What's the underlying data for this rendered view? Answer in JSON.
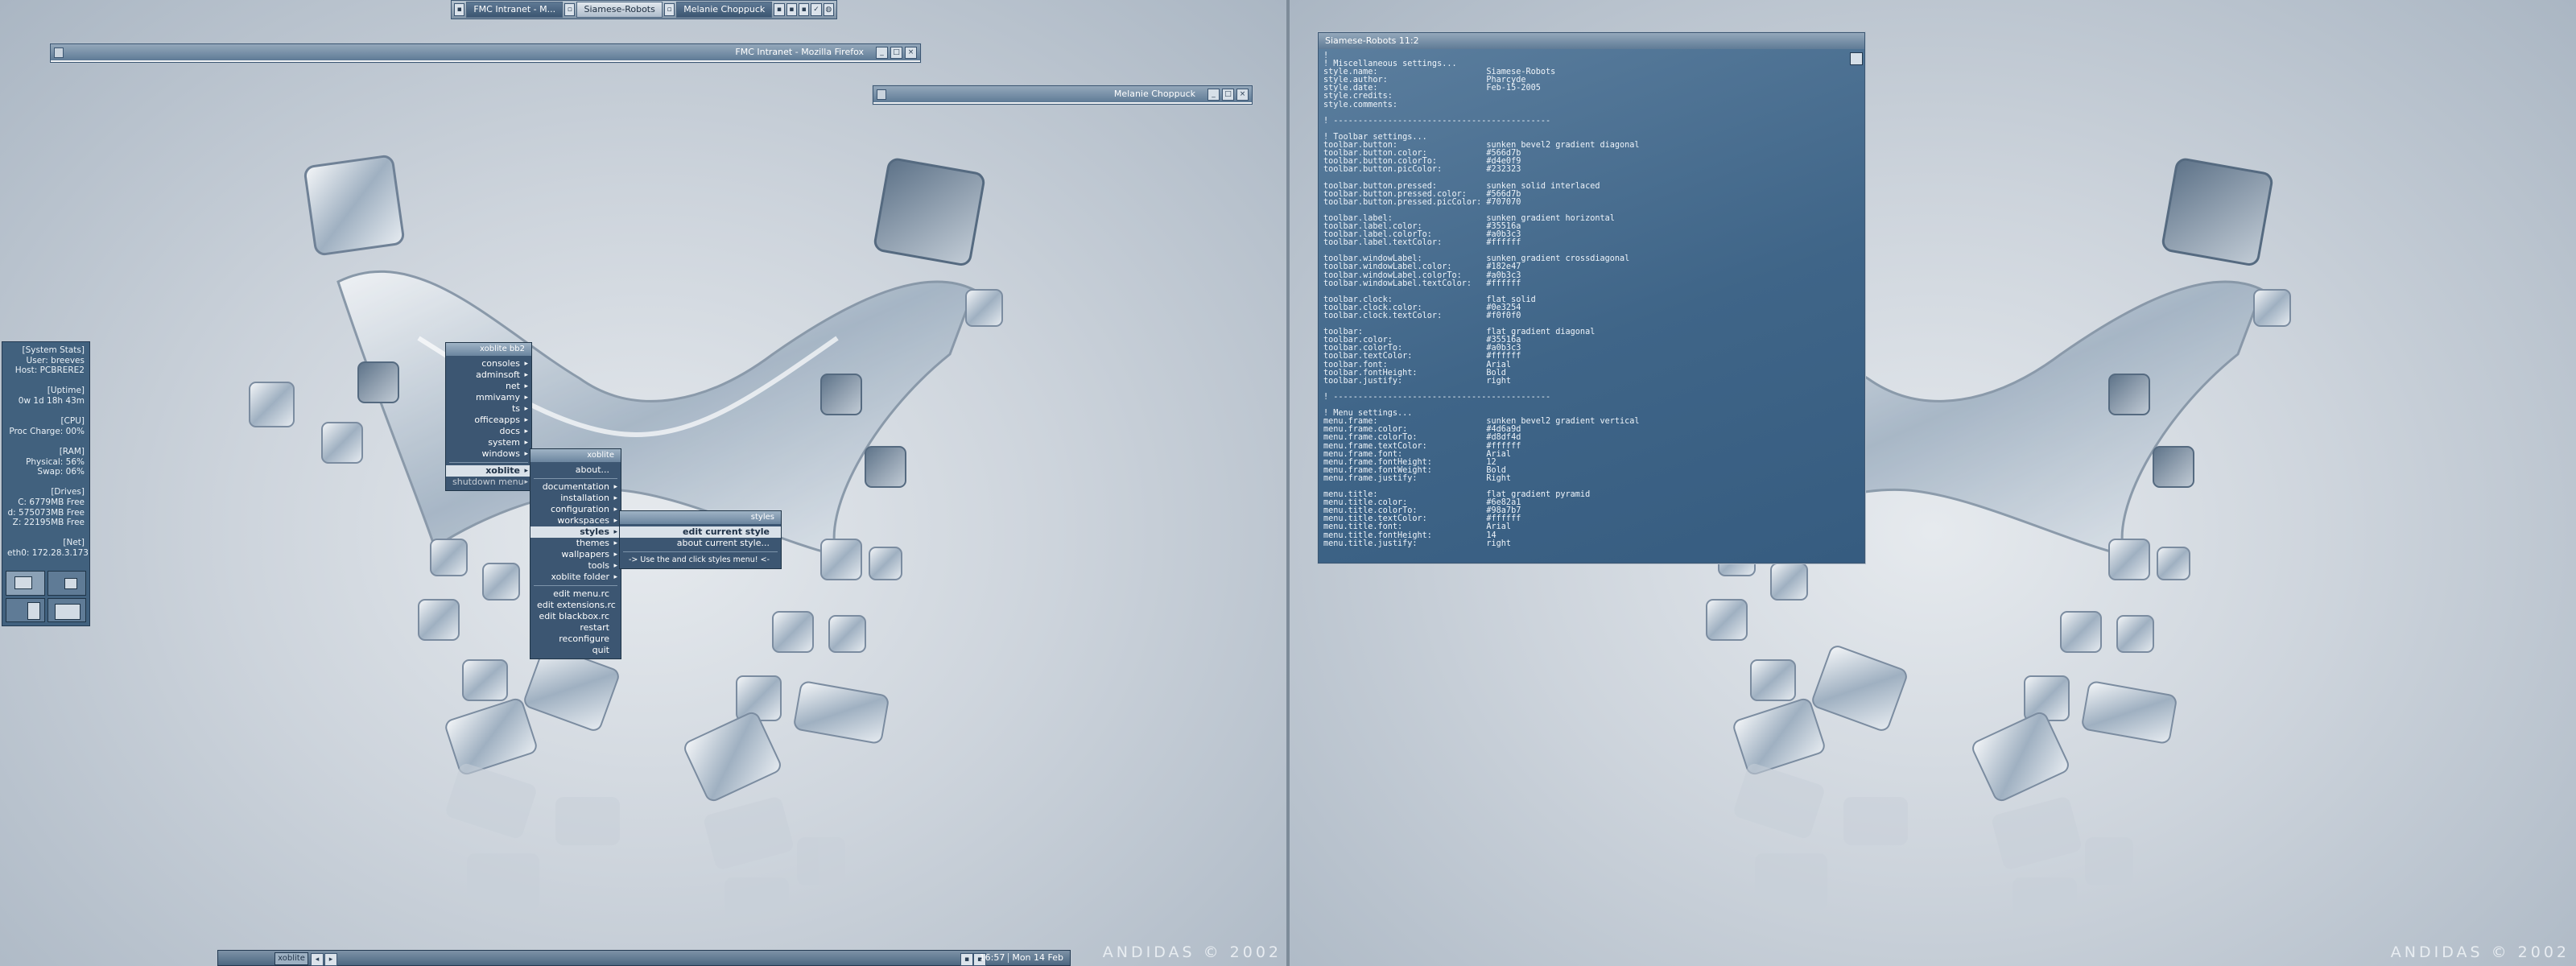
{
  "top_taskbar": {
    "tasks": [
      {
        "label": "FMC Intranet - M..."
      },
      {
        "label": "Siamese-Robots"
      },
      {
        "label": "Melanie Choppuck"
      }
    ]
  },
  "windows": {
    "firefox_title": "FMC Intranet - Mozilla Firefox",
    "melanie_title": "Melanie Choppuck",
    "terminal_title": "Siamese-Robots  11:2"
  },
  "system_stats": {
    "lines": [
      "[System Stats]",
      "User: breeves",
      "Host: PCBRERE2",
      "",
      "[Uptime]",
      "0w 1d 18h 43m",
      "",
      "[CPU]",
      "Proc Charge: 00%",
      "",
      "[RAM]",
      "Physical: 56%",
      "Swap: 06%",
      "",
      "[Drives]",
      "C: 6779MB Free",
      "d: 575073MB Free",
      "Z: 22195MB Free",
      "",
      "[Net]",
      "eth0: 172.28.3.173"
    ]
  },
  "menus": {
    "root": {
      "title": "xoblite bb2",
      "items": [
        "consoles",
        "adminsoft",
        "net",
        "mmivamy",
        "ts",
        "officeapps",
        "docs",
        "system",
        "windows",
        "xoblite",
        "shutdown menu"
      ]
    },
    "xoblite": {
      "title": "xoblite",
      "items": [
        "about...",
        "documentation",
        "installation",
        "configuration",
        "workspaces",
        "styles",
        "themes",
        "wallpapers",
        "tools",
        "xoblite folder",
        "edit menu.rc",
        "edit extensions.rc",
        "edit blackbox.rc",
        "restart",
        "reconfigure",
        "quit"
      ]
    },
    "styles": {
      "title": "styles",
      "items": [
        "edit current style",
        "about current style...",
        "-> Use the and click styles menu! <-"
      ]
    }
  },
  "terminal": {
    "lines": [
      "!",
      "! Miscellaneous settings...",
      "style.name:                      Siamese-Robots",
      "style.author:                    Pharcyde",
      "style.date:                      Feb-15-2005",
      "style.credits:",
      "style.comments:",
      "",
      "! --------------------------------------------",
      "",
      "! Toolbar settings...",
      "toolbar.button:                  sunken bevel2 gradient diagonal",
      "toolbar.button.color:            #566d7b",
      "toolbar.button.colorTo:          #d4e0f9",
      "toolbar.button.picColor:         #232323",
      "",
      "toolbar.button.pressed:          sunken solid interlaced",
      "toolbar.button.pressed.color:    #566d7b",
      "toolbar.button.pressed.picColor: #707070",
      "",
      "toolbar.label:                   sunken gradient horizontal",
      "toolbar.label.color:             #35516a",
      "toolbar.label.colorTo:           #a0b3c3",
      "toolbar.label.textColor:         #ffffff",
      "",
      "toolbar.windowLabel:             sunken gradient crossdiagonal",
      "toolbar.windowLabel.color:       #182e47",
      "toolbar.windowLabel.colorTo:     #a0b3c3",
      "toolbar.windowLabel.textColor:   #ffffff",
      "",
      "toolbar.clock:                   flat solid",
      "toolbar.clock.color:             #0e3254",
      "toolbar.clock.textColor:         #f0f0f0",
      "",
      "toolbar:                         flat gradient diagonal",
      "toolbar.color:                   #35516a",
      "toolbar.colorTo:                 #a0b3c3",
      "toolbar.textColor:               #ffffff",
      "toolbar.font:                    Arial",
      "toolbar.fontHeight:              Bold",
      "toolbar.justify:                 right",
      "",
      "! --------------------------------------------",
      "",
      "! Menu settings...",
      "menu.frame:                      sunken bevel2 gradient vertical",
      "menu.frame.color:                #4d6a9d",
      "menu.frame.colorTo:              #d8df4d",
      "menu.frame.textColor:            #ffffff",
      "menu.frame.font:                 Arial",
      "menu.frame.fontHeight:           12",
      "menu.frame.fontWeight:           Bold",
      "menu.frame.justify:              Right",
      "",
      "menu.title:                      flat gradient pyramid",
      "menu.title.color:                #6e82a1",
      "menu.title.colorTo:              #98a7b7",
      "menu.title.textColor:            #ffffff",
      "menu.title.font:                 Arial",
      "menu.title.fontHeight:           14",
      "menu.title.justify:              right"
    ]
  },
  "bottom_taskbar": {
    "workspace": "xoblite",
    "time": "16:57",
    "date": "Mon 14 Feb"
  },
  "watermark": "ANDIDAS © 2002",
  "colors": {
    "accent": "#3c5672",
    "terminal_bg": "#41678a",
    "stats_bg": "#41617e"
  }
}
